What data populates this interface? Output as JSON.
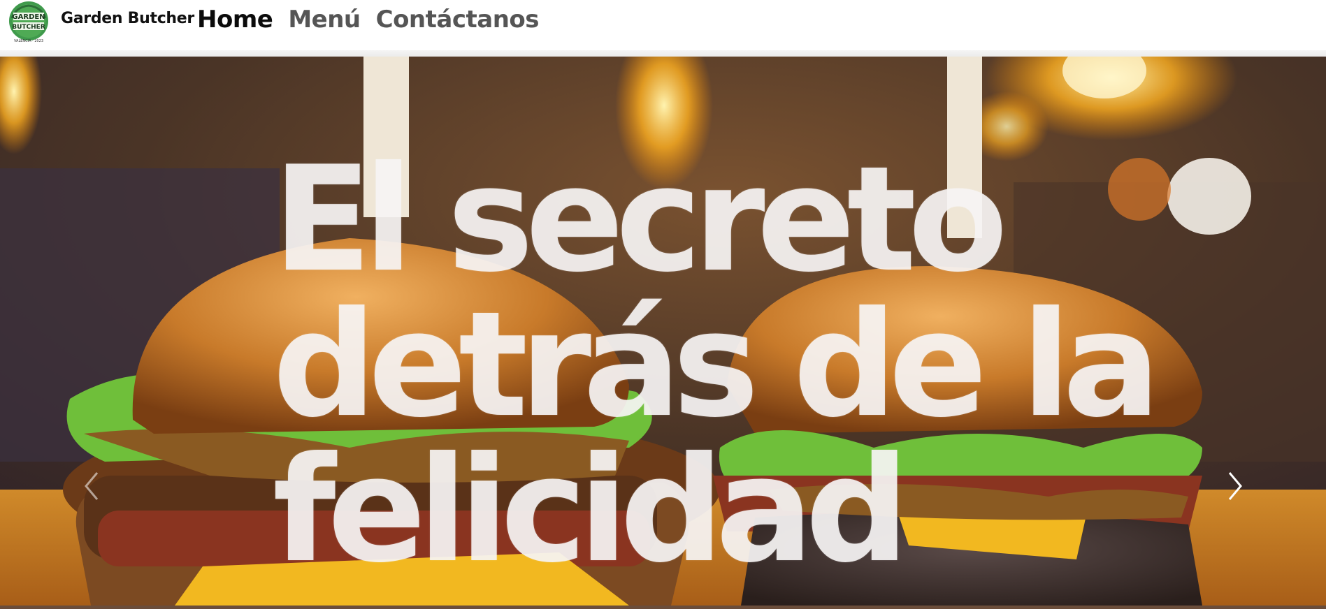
{
  "navbar": {
    "brand": "Garden Butcher",
    "logo": {
      "top_text": "GARDEN",
      "bottom_text": "BUTCHER",
      "caption": "VALENCIA · 2023",
      "color": "#3f9a4c"
    },
    "links": [
      {
        "label": "Home",
        "active": true
      },
      {
        "label": "Menú",
        "active": false
      },
      {
        "label": "Contáctanos",
        "active": false
      }
    ]
  },
  "hero": {
    "title_lines": [
      "El secreto",
      "detrás de la",
      "felicidad"
    ],
    "prev_icon": "chevron-left-icon",
    "next_icon": "chevron-right-icon"
  },
  "colors": {
    "nav_active": "#0b0b0b",
    "nav_inactive": "#555555",
    "hero_text": "#f6f4f4",
    "lettuce": "#6fbf3a",
    "bun": "#c87a2a",
    "sauce": "#8a5a22",
    "cheese": "#f2b820"
  }
}
